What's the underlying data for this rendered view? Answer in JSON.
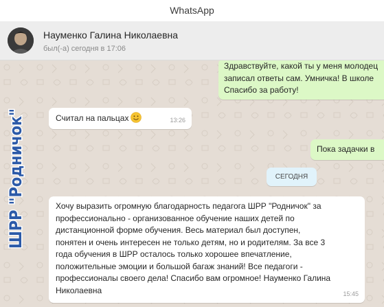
{
  "window": {
    "title": "WhatsApp"
  },
  "header": {
    "contact_name": "Науменко Галина Николаевна",
    "last_seen": "был(-а) сегодня в 17:06"
  },
  "watermark": {
    "text": "ШРР \"Родничок\""
  },
  "messages": [
    {
      "direction": "outgoing",
      "lines": [
        "Здравствуйте, какой ты у меня молодец",
        "записал ответы сам. Умничка! В школе",
        "Спасибо за работу!"
      ]
    },
    {
      "direction": "incoming",
      "text": "Считал на пальцах",
      "emoji": "smiling-face-icon",
      "time": "13:26"
    },
    {
      "direction": "outgoing",
      "text": "Пока задачки в"
    },
    {
      "direction": "incoming",
      "lines": [
        "Хочу выразить огромную благодарность педагога ШРР \"Родничок\" за",
        "профессионально - организованное обучение наших детей по",
        "дистанционной форме обучения. Весь материал был доступен,",
        "понятен и очень интересен не только детям, но и родителям. За все 3",
        "года обучения в ШРР осталось только хорошее впечатление,",
        "положительные эмоции и большой багаж знаний! Все педагоги -",
        "профессионалы своего дела! Спасибо вам огромное! Науменко Галина",
        "Николаевна"
      ],
      "time": "15:45"
    }
  ],
  "date_divider": {
    "label": "СЕГОДНЯ"
  },
  "colors": {
    "chat_background": "#e5ddd5",
    "outgoing_bubble": "#dcf8c6",
    "incoming_bubble": "#ffffff",
    "date_pill": "#e1f3fb",
    "watermark_fill": "#2c5aa8",
    "watermark_stroke": "#ffffff"
  }
}
